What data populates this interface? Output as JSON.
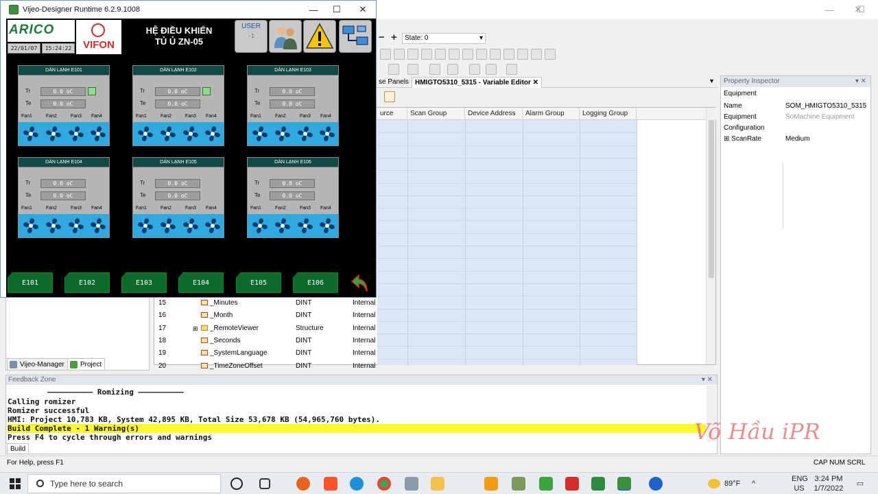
{
  "runtime_window": {
    "title": "Vijeo-Designer Runtime 6.2.9.1008",
    "controls": {
      "minimize": "—",
      "maximize": "☐",
      "close": "✕"
    }
  },
  "hmi": {
    "logo": "ARICO",
    "brand": "VIFON",
    "date": "22/01/07",
    "time": "15:24:22",
    "heading_line1": "HỆ ĐIỀU KHIỂN",
    "heading_line2": "TỦ Ủ ZN-05",
    "user_label": "USER",
    "user_value": "-1",
    "units": [
      {
        "title": "DÀN LẠNH E101",
        "tr_label": "Tr",
        "te_label": "Te",
        "tr": "0.0 oC",
        "te": "0.0 oC",
        "indicator": true,
        "fans": [
          "Fan1",
          "Fan2",
          "Fan3",
          "Fan4"
        ]
      },
      {
        "title": "DÀN LẠNH E102",
        "tr_label": "Tr",
        "te_label": "Te",
        "tr": "0.0 oC",
        "te": "0.0 oC",
        "indicator": true,
        "fans": [
          "Fan1",
          "Fan2",
          "Fan3",
          "Fan4"
        ]
      },
      {
        "title": "DÀN LẠNH E103",
        "tr_label": "Tr",
        "te_label": "Te",
        "tr": "0.0 oC",
        "te": "0.0 oC",
        "indicator": false,
        "fans": [
          "Fan1",
          "Fan2",
          "Fan3",
          "Fan4"
        ]
      },
      {
        "title": "DÀN LẠNH E104",
        "tr_label": "Tr",
        "te_label": "Te",
        "tr": "0.0 oC",
        "te": "0.0 oC",
        "indicator": false,
        "fans": [
          "Fan1",
          "Fan2",
          "Fan3",
          "Fan4"
        ]
      },
      {
        "title": "DÀN LẠNH E105",
        "tr_label": "Tr",
        "te_label": "Te",
        "tr": "0.0 oC",
        "te": "0.0 oC",
        "indicator": false,
        "fans": [
          "Fan1",
          "Fan2",
          "Fan3",
          "Fan4"
        ]
      },
      {
        "title": "DÀN LẠNH E106",
        "tr_label": "Tr",
        "te_label": "Te",
        "tr": "0.0 oC",
        "te": "0.0 oC",
        "indicator": false,
        "fans": [
          "Fan1",
          "Fan2",
          "Fan3",
          "Fan4"
        ]
      }
    ],
    "nav_buttons": [
      "E101",
      "E102",
      "E103",
      "E104",
      "E105",
      "E106"
    ]
  },
  "ide": {
    "state_label": "State: 0",
    "tabs": [
      "se Panels",
      "HMIGTO5310_5315 - Variable Editor"
    ],
    "columns": [
      "urce",
      "Scan Group",
      "Device Address",
      "Alarm Group",
      "Logging Group"
    ],
    "rows": [
      {
        "num": "15",
        "name": "_Minutes",
        "type": "DINT",
        "source": "Internal",
        "expand": false
      },
      {
        "num": "16",
        "name": "_Month",
        "type": "DINT",
        "source": "Internal",
        "expand": false
      },
      {
        "num": "17",
        "name": "_RemoteViewer",
        "type": "Structure",
        "source": "Internal",
        "expand": true
      },
      {
        "num": "18",
        "name": "_Seconds",
        "type": "DINT",
        "source": "Internal",
        "expand": false
      },
      {
        "num": "19",
        "name": "_SystemLanguage",
        "type": "DINT",
        "source": "Internal",
        "expand": false
      },
      {
        "num": "20",
        "name": "_TimeZoneOffset",
        "type": "DINT",
        "source": "Internal",
        "expand": false
      }
    ],
    "property_inspector": {
      "title": "Property Inspector",
      "section": "Equipment",
      "props": [
        {
          "key": "Name",
          "value": "SOM_HMIGTO5310_5315"
        },
        {
          "key": "Equipment",
          "value": "SoMachine Equipment"
        },
        {
          "key": "Configuration",
          "value": ""
        },
        {
          "key": "⊞  ScanRate",
          "value": "Medium"
        }
      ]
    },
    "left_tabs": [
      "Vijeo-Manager",
      "Project"
    ],
    "feedback": {
      "title": "Feedback Zone",
      "heading": "—————————— Romizing ——————————",
      "lines": [
        "Calling romizer",
        "Romizer successful",
        "HMI: Project 10,783 KB, System 42,895 KB, Total Size 53,678 KB (54,965,760 bytes).",
        "Build Complete - 1 Warning(s)",
        "Press F4 to cycle through errors and warnings"
      ],
      "tab": "Build"
    },
    "status_left": "For Help, press F1",
    "status_right": "CAP  NUM  SCRL",
    "watermark": "Võ Hầu iPR"
  },
  "taskbar": {
    "search_placeholder": "Type here to search",
    "weather": "89°F",
    "lang_line1": "ENG",
    "lang_line2": "US",
    "clock_time": "3:24 PM",
    "clock_date": "1/7/2022"
  },
  "colors": {
    "hmi_bg": "#000000",
    "unit_title_bg": "#0f4a45",
    "fan_bg": "#2fa9e0",
    "nav_green": "#0c6a2b",
    "build_highlight": "#fcf92a"
  }
}
